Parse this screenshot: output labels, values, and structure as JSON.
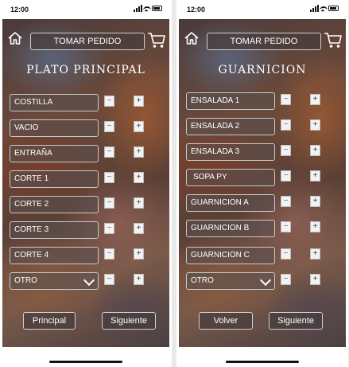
{
  "status_bar": {
    "time": "12:00"
  },
  "screens": [
    {
      "top_button": "TOMAR PEDIDO",
      "heading": "PLATO PRINCIPAL",
      "items": [
        {
          "label": "COSTILLA"
        },
        {
          "label": "VACIO"
        },
        {
          "label": "ENTRAÑA"
        },
        {
          "label": "CORTE 1"
        },
        {
          "label": "CORTE 2"
        },
        {
          "label": "CORTE 3"
        },
        {
          "label": "CORTE 4"
        },
        {
          "label": "OTRO"
        }
      ],
      "minus_symbol": "−",
      "plus_symbol": "+",
      "buttons": {
        "back": "Principal",
        "next": "Siguiente"
      }
    },
    {
      "top_button": "TOMAR PEDIDO",
      "heading": "GUARNICION",
      "items": [
        {
          "label": "ENSALADA 1"
        },
        {
          "label": "ENSALADA 2"
        },
        {
          "label": "ENSALADA 3"
        },
        {
          "label": "SOPA PY"
        },
        {
          "label": "GUARNICION A"
        },
        {
          "label": "GUARNICION B"
        },
        {
          "label": "GUARNICION C"
        },
        {
          "label": "OTRO"
        }
      ],
      "minus_symbol": "−",
      "plus_symbol": "+",
      "buttons": {
        "back": "Volver",
        "next": "Siguiente"
      }
    }
  ],
  "icons": [
    "home-icon",
    "cart-icon",
    "chevron-down-icon",
    "signal-icon",
    "wifi-icon",
    "battery-icon"
  ],
  "colors": {
    "button_fill": "#463c3c",
    "button_border": "#cfcfcf",
    "text": "#ffffff"
  }
}
